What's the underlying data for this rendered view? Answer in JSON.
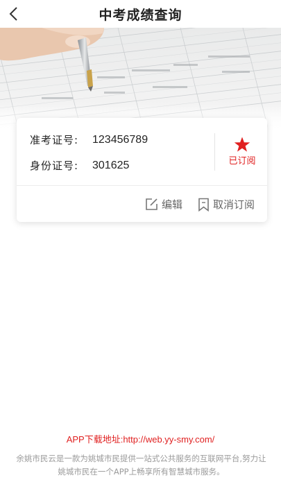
{
  "header": {
    "title": "中考成绩查询",
    "back_icon": "chevron-left-icon"
  },
  "banner": {
    "description_icon": "pen-on-exam-paper-image"
  },
  "card": {
    "exam_no_label": "准考证号:",
    "exam_no_value": "123456789",
    "id_label": "身份证号:",
    "id_value": "301625",
    "subscribed_label": "已订阅",
    "subscribed_icon": "star-icon",
    "edit_label": "编辑",
    "edit_icon": "edit-icon",
    "unsubscribe_label": "取消订阅",
    "unsubscribe_icon": "bookmark-icon"
  },
  "footer": {
    "download_text": "APP下载地址:http://web.yy-smy.com/",
    "description": "余姚市民云是一款为姚城市民提供一站式公共服务的互联网平台,努力让姚城市民在一个APP上畅享所有智慧城市服务。"
  },
  "colors": {
    "accent": "#e02020",
    "text": "#222222",
    "muted": "#9b9b9b",
    "action_gray": "#666666"
  }
}
